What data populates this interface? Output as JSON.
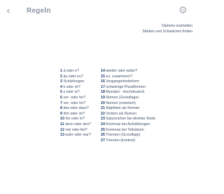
{
  "header": {
    "title": "Regeln",
    "back_glyph": "‹",
    "back_icon": "chevron-left-icon",
    "settings_glyph": "⚙",
    "settings_icon": "gear-icon"
  },
  "links": [
    {
      "label": "Diplome erarbeiten"
    },
    {
      "label": "Stärken und Schwächen finden"
    }
  ],
  "rules_left": [
    {
      "num": "1",
      "label": "ä oder e?"
    },
    {
      "num": "2",
      "label": "äu oder eu?"
    },
    {
      "num": "3",
      "label": "Schärfungen"
    },
    {
      "num": "4",
      "label": "k oder ck?"
    },
    {
      "num": "5",
      "label": "z oder tz?"
    },
    {
      "num": "6",
      "label": "ver- oder fer?"
    },
    {
      "num": "7",
      "label": "vor- oder for?"
    },
    {
      "num": "8",
      "label": "das oder dass?"
    },
    {
      "num": "9",
      "label": "ihm oder im?"
    },
    {
      "num": "10",
      "label": "ihn oder in?"
    },
    {
      "num": "11",
      "label": "denn oder den?"
    },
    {
      "num": "12",
      "label": "viel oder fiel?"
    },
    {
      "num": "13",
      "label": "wahr oder war?"
    }
  ],
  "rules_right": [
    {
      "num": "14",
      "label": "wieder oder wider?"
    },
    {
      "num": "15",
      "label": "zu: zusammen?"
    },
    {
      "num": "16",
      "label": "Vergangenheitsform"
    },
    {
      "num": "17",
      "label": "schwierige Pluralformen"
    },
    {
      "num": "18",
      "label": "Mundart - Hochdeutsch"
    },
    {
      "num": "19",
      "label": "Nomen (Grundlage)"
    },
    {
      "num": "20",
      "label": "Nomen (erweitert)"
    },
    {
      "num": "21",
      "label": "Adjektive als Nomen"
    },
    {
      "num": "22",
      "label": "Verben als Nomen"
    },
    {
      "num": "23",
      "label": "Satzzeichen bei direkter Rede"
    },
    {
      "num": "24",
      "label": "Kommas bei Aufzählungen"
    },
    {
      "num": "25",
      "label": "Kommas bei Teilsätzen"
    },
    {
      "num": "26",
      "label": "Trennen (Grundlage)"
    },
    {
      "num": "27",
      "label": "Trennen (konkret)"
    }
  ]
}
